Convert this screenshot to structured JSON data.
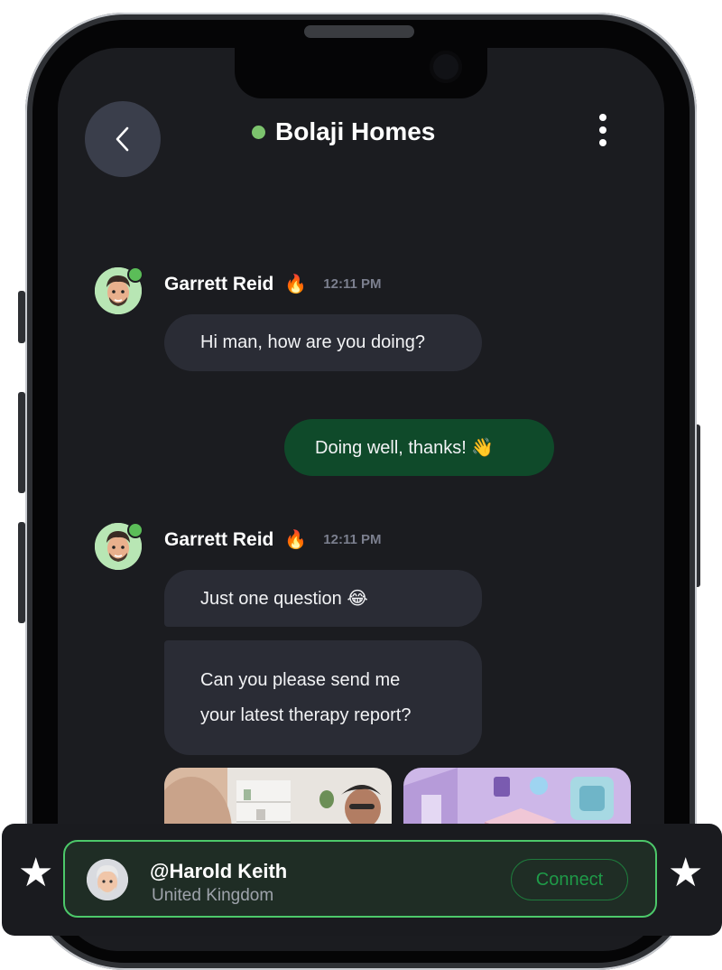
{
  "header": {
    "title": "Bolaji Homes",
    "back_icon": "chevron-left-icon",
    "more_icon": "more-vertical-icon",
    "status_color": "#7cc36d"
  },
  "messages": [
    {
      "sender": "Garrett Reid",
      "sender_emoji": "🔥",
      "time": "12:11 PM",
      "bubbles": [
        "Hi man, how are you doing?"
      ]
    },
    {
      "outgoing": true,
      "text": "Doing well, thanks! 👋"
    },
    {
      "sender": "Garrett Reid",
      "sender_emoji": "🔥",
      "time": "12:11 PM",
      "bubbles": [
        "Just one question 😂",
        "Can you please send me",
        "your latest therapy report?"
      ]
    }
  ],
  "bottom_bar": {
    "username": "@Harold Keith",
    "location": "United Kingdom",
    "connect_label": "Connect",
    "left_icon": "star-icon",
    "right_icon": "star-icon",
    "star_glyph": "★",
    "accent_color": "#4cc86a"
  },
  "colors": {
    "screen_bg": "#1b1c20",
    "bubble_in": "#2a2c35",
    "bubble_out": "#0f4a2a"
  }
}
